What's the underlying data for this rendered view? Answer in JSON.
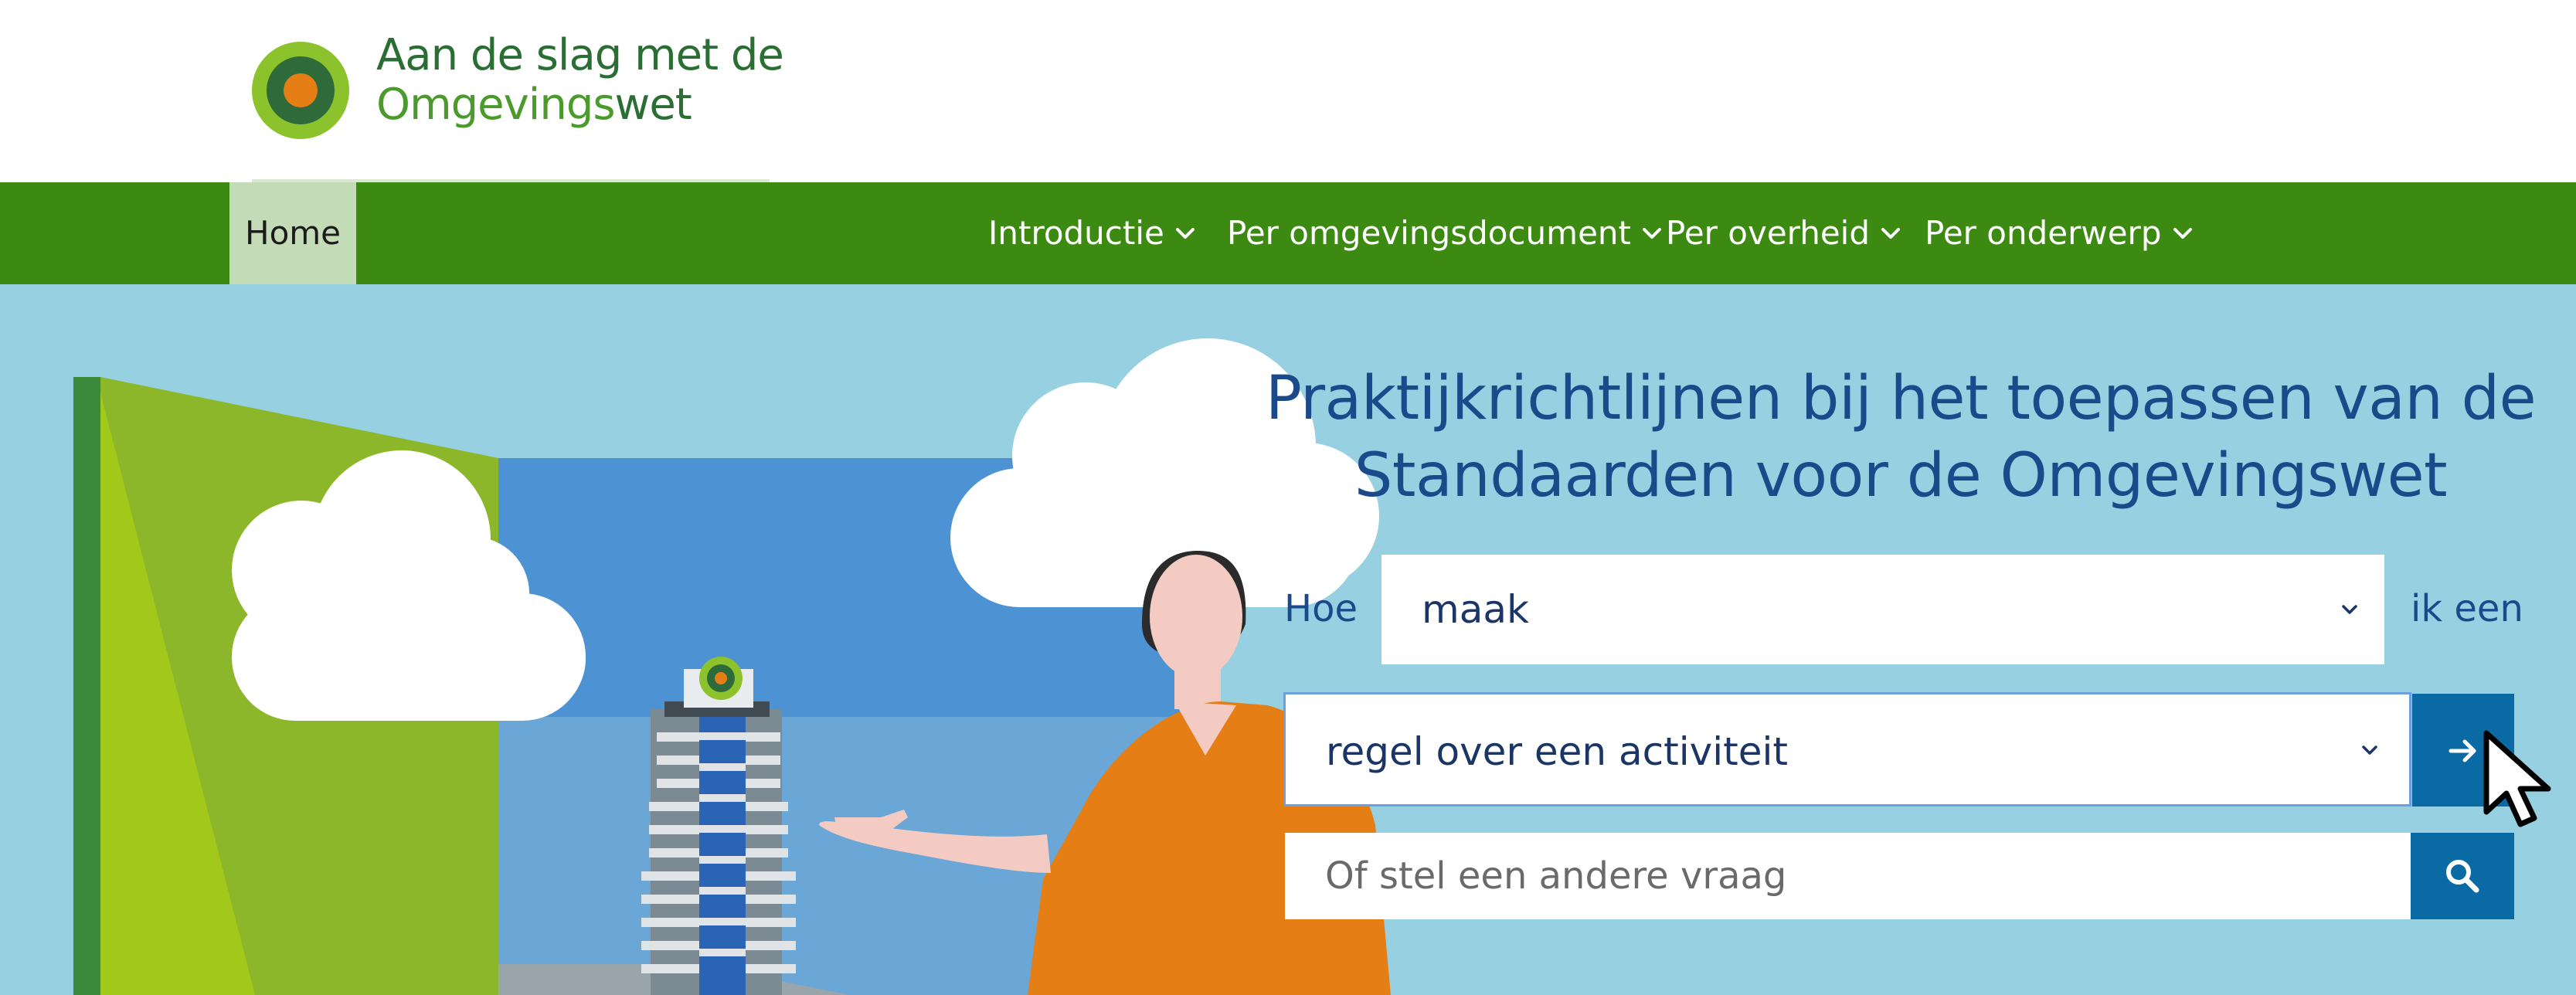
{
  "header": {
    "logo": {
      "line1": "Aan de slag met de",
      "line2_prefix": "Omgevings",
      "line2_suffix": "wet"
    }
  },
  "nav": {
    "home": "Home",
    "items": [
      {
        "label": "Introductie",
        "icon": "chevron-down-icon"
      },
      {
        "label": "Per omgevingsdocument",
        "icon": "chevron-down-icon"
      },
      {
        "label": "Per overheid",
        "icon": "chevron-down-icon"
      },
      {
        "label": "Per onderwerp",
        "icon": "chevron-down-icon"
      }
    ]
  },
  "hero": {
    "title_line1": "Praktijkrichtlijnen bij het toepassen van de",
    "title_line2": "Standaarden voor de Omgevingswet",
    "question": {
      "prefix": "Hoe",
      "verb_selected": "maak",
      "suffix": "ik een",
      "object_selected": "regel over een activiteit",
      "go_icon": "arrow-right-icon"
    },
    "search": {
      "placeholder": "Of stel een andere vraag",
      "icon": "search-icon"
    }
  },
  "colors": {
    "nav_green": "#3c8a12",
    "home_tab": "#c3dbb6",
    "hero_bg": "#96d0e1",
    "title_blue": "#1b4a8b",
    "button_blue": "#0a6aa3"
  }
}
